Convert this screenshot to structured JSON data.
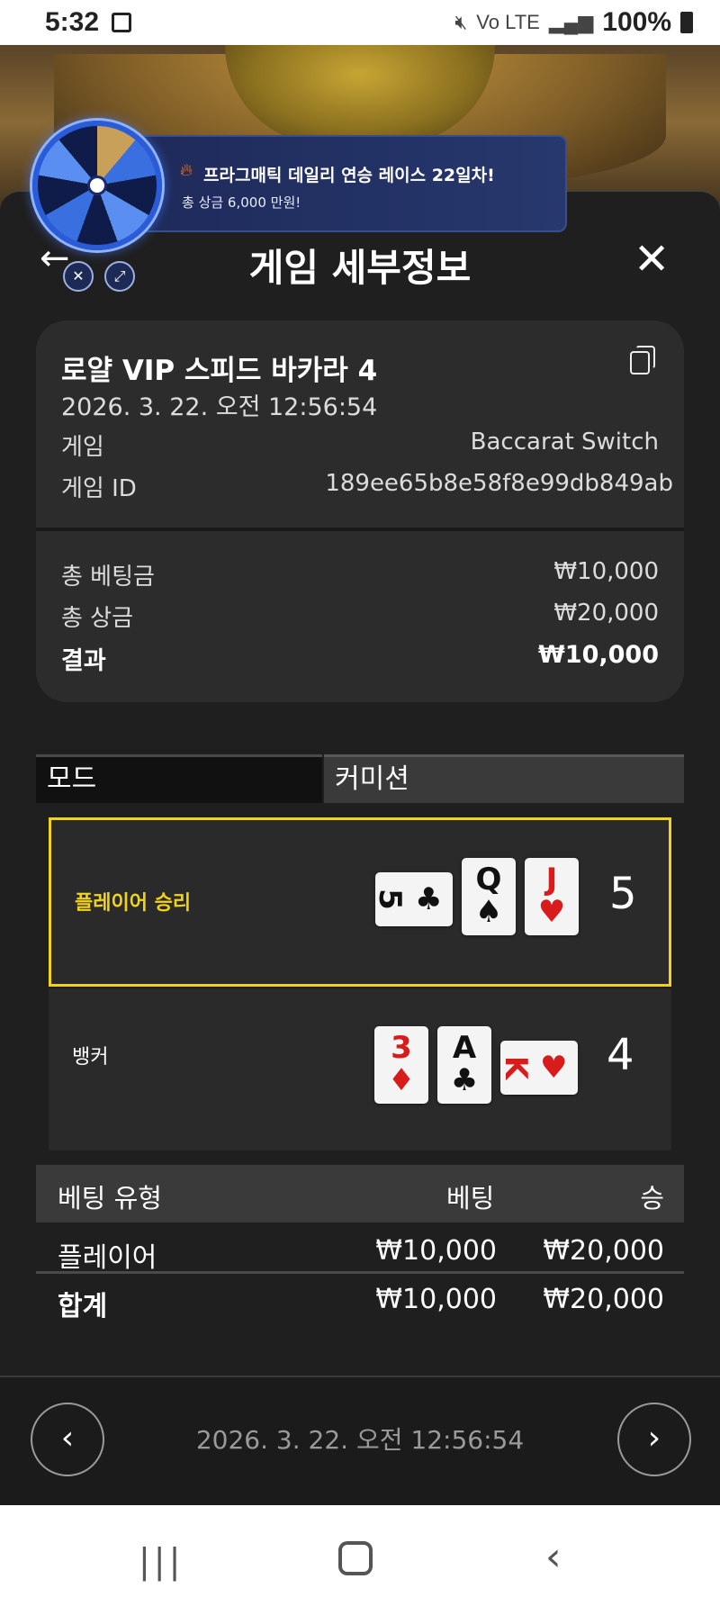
{
  "status_bar": {
    "time": "5:32",
    "signal_text": "Vo LTE",
    "battery": "100%"
  },
  "promo": {
    "title": "프라그매틱 데일리 연승 레이스 22일차!",
    "subtitle": "총 상금 6,000 만원!"
  },
  "header": {
    "title": "게임 세부정보"
  },
  "game": {
    "room_name": "로얄 VIP 스피드 바카라 4",
    "datetime": "2026. 3. 22. 오전 12:56:54",
    "game_label": "게임",
    "game_value": "Baccarat Switch",
    "id_label": "게임 ID",
    "id_value": "189ee65b8e58f8e99db849ab"
  },
  "summary": {
    "total_bet_label": "총 베팅금",
    "total_bet_value": "₩10,000",
    "total_prize_label": "총 상금",
    "total_prize_value": "₩20,000",
    "result_label": "결과",
    "result_value": "₩10,000"
  },
  "tabs": {
    "mode": "모드",
    "commission": "커미션"
  },
  "outcome": {
    "player_label": "플레이어 승리",
    "player_score": "5",
    "player_cards": [
      {
        "rank": "5",
        "suit": "♣",
        "color": "black"
      },
      {
        "rank": "Q",
        "suit": "♠",
        "color": "black"
      },
      {
        "rank": "J",
        "suit": "♥",
        "color": "red"
      }
    ],
    "banker_label": "뱅커",
    "banker_score": "4",
    "banker_cards": [
      {
        "rank": "3",
        "suit": "♦",
        "color": "red"
      },
      {
        "rank": "A",
        "suit": "♣",
        "color": "black"
      },
      {
        "rank": "K",
        "suit": "♥",
        "color": "red"
      }
    ]
  },
  "bets": {
    "headers": {
      "type": "베팅 유형",
      "bet": "베팅",
      "win": "승"
    },
    "rows": [
      {
        "type": "플레이어",
        "bet": "₩10,000",
        "win": "₩20,000"
      }
    ],
    "total": {
      "type": "합계",
      "bet": "₩10,000",
      "win": "₩20,000"
    }
  },
  "footer": {
    "datetime": "2026. 3. 22. 오전 12:56:54"
  },
  "colors": {
    "accent_yellow": "#f2d21a",
    "panel": "#1f1f1f",
    "card_bg": "#2c2c2c"
  }
}
